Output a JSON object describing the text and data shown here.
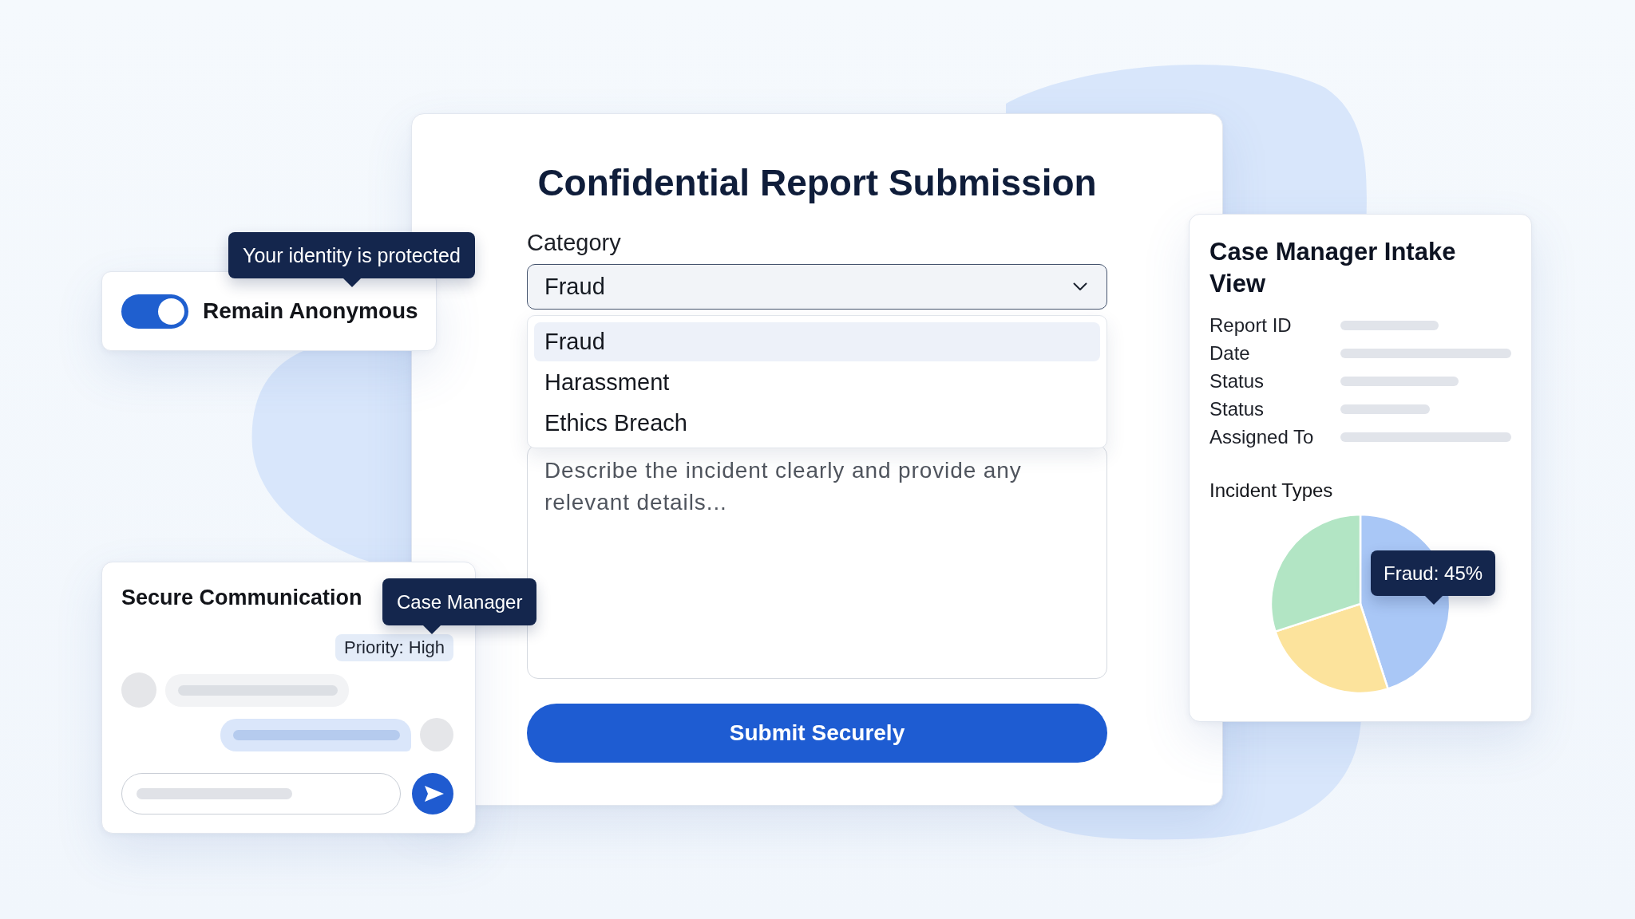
{
  "anonymity": {
    "tooltip": "Your identity is protected",
    "label": "Remain Anonymous",
    "on": true
  },
  "report_form": {
    "title": "Confidential Report Submission",
    "category": {
      "label": "Category",
      "value": "Fraud",
      "expanded": true,
      "options": [
        {
          "label": "Fraud",
          "selected": true
        },
        {
          "label": "Harassment",
          "selected": false
        },
        {
          "label": "Ethics Breach",
          "selected": false
        }
      ]
    },
    "description": {
      "placeholder": "Describe the incident clearly and provide any relevant details..."
    },
    "submit_button": "Submit Securely"
  },
  "secure_communication": {
    "title": "Secure Communication",
    "tooltip": "Case Manager",
    "priority": "Priority: High",
    "messages": [
      {
        "kind": "incoming"
      },
      {
        "kind": "outgoing"
      }
    ]
  },
  "intake_view": {
    "title": "Case Manager Intake View",
    "fields": [
      {
        "label": "Report ID"
      },
      {
        "label": "Date"
      },
      {
        "label": "Status"
      },
      {
        "label": "Status"
      },
      {
        "label": "Assigned To"
      }
    ],
    "chart_data": {
      "type": "pie",
      "title": "Incident Types",
      "values": [
        45,
        25,
        30
      ],
      "colors": [
        "#a9c7f6",
        "#fce39c",
        "#b2e5c4"
      ]
    },
    "chart_tooltip": "Fraud: 45%"
  }
}
